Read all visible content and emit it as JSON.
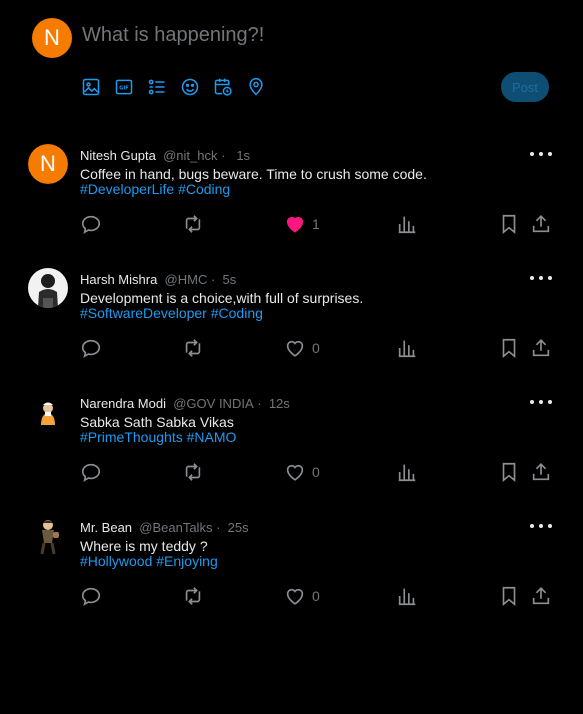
{
  "composer": {
    "avatar_letter": "N",
    "placeholder": "What is happening?!",
    "tools": [
      "image-icon",
      "gif-icon",
      "poll-icon",
      "emoji-icon",
      "schedule-icon",
      "location-icon"
    ],
    "post_label": "Post"
  },
  "colors": {
    "accent": "#1d9bf0",
    "like": "#f91880",
    "avatar_orange": "#f57c00",
    "muted": "#71767b"
  },
  "tweets": [
    {
      "name": "Nitesh Gupta",
      "handle": "@nit_hck",
      "dot": "·",
      "time": "1s",
      "text": "Coffee in hand, bugs beware. Time to crush some code.",
      "tags": [
        "#DeveloperLife",
        "#Coding"
      ],
      "likes": "1",
      "liked": true,
      "avatar": "N"
    },
    {
      "name": "Harsh Mishra",
      "handle": "@HMC",
      "dot": "·",
      "time": "5s",
      "text": "Development is a choice,with full of surprises.",
      "tags": [
        "#SoftwareDeveloper",
        "#Coding"
      ],
      "likes": "0",
      "liked": false,
      "avatar": "photo"
    },
    {
      "name": "Narendra Modi",
      "handle": "@GOV INDIA",
      "dot": "·",
      "time": "12s",
      "text": "Sabka Sath Sabka Vikas",
      "tags": [
        "#PrimeThoughts",
        "#NAMO"
      ],
      "likes": "0",
      "liked": false,
      "avatar": "photo"
    },
    {
      "name": "Mr. Bean",
      "handle": "@BeanTalks",
      "dot": "·",
      "time": "25s",
      "text": "Where is my teddy ?",
      "tags": [
        "#Hollywood",
        "#Enjoying"
      ],
      "likes": "0",
      "liked": false,
      "avatar": "photo"
    }
  ]
}
